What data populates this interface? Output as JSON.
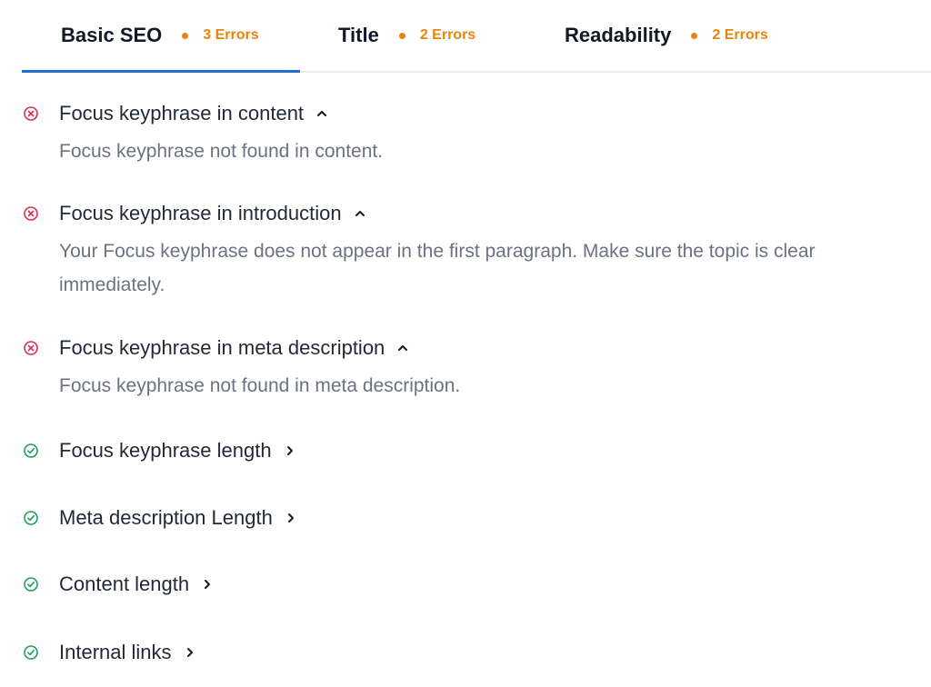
{
  "tabs": [
    {
      "label": "Basic SEO",
      "count": "3 Errors"
    },
    {
      "label": "Title",
      "count": "2 Errors"
    },
    {
      "label": "Readability",
      "count": "2 Errors"
    }
  ],
  "checks": [
    {
      "title": "Focus keyphrase in content",
      "status": "error",
      "expanded": true,
      "description": "Focus keyphrase not found in content."
    },
    {
      "title": "Focus keyphrase in introduction",
      "status": "error",
      "expanded": true,
      "description": "Your Focus keyphrase does not appear in the first paragraph. Make sure the topic is clear immediately."
    },
    {
      "title": "Focus keyphrase in meta description",
      "status": "error",
      "expanded": true,
      "description": "Focus keyphrase not found in meta description."
    },
    {
      "title": "Focus keyphrase length",
      "status": "ok",
      "expanded": false
    },
    {
      "title": "Meta description Length",
      "status": "ok",
      "expanded": false
    },
    {
      "title": "Content length",
      "status": "ok",
      "expanded": false
    },
    {
      "title": "Internal links",
      "status": "ok",
      "expanded": false
    }
  ],
  "colors": {
    "accent_underline": "#1e6fd0",
    "warning_orange": "#e8850c",
    "error_red": "#dc2f4f",
    "ok_green": "#1e9e5c"
  },
  "icons": {
    "error": "x-circle-icon",
    "ok": "check-circle-icon",
    "expanded": "chevron-up-icon",
    "collapsed": "chevron-right-icon"
  }
}
